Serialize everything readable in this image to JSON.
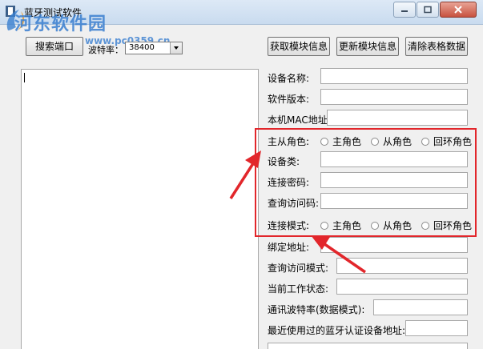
{
  "window": {
    "title": "蓝牙测试软件",
    "watermark": "河东软件园",
    "watermark_url": "www.pc0359.cn"
  },
  "toolbar": {
    "search_port_label": "搜索端口",
    "baud_label": "波特率：",
    "baud_value": "38400",
    "get_info_label": "获取模块信息",
    "update_info_label": "更新模块信息",
    "clear_table_label": "清除表格数据"
  },
  "fields": {
    "device_name": "设备名称:",
    "software_version": "软件版本:",
    "local_mac": "本机MAC地址:",
    "master_slave_role": "主从角色:",
    "device_class": "设备类:",
    "pair_password": "连接密码:",
    "inquiry_code": "查询访问码:",
    "connect_mode": "连接模式:",
    "bind_address": "绑定地址:",
    "inquiry_mode": "查询访问模式:",
    "current_state": "当前工作状态:",
    "baud_rate_data_mode": "通讯波特率(数据模式):",
    "recent_device_address": "最近使用过的蓝牙认证设备地址:"
  },
  "role_options": {
    "master": "主角色",
    "slave": "从角色",
    "loopback": "回环角色"
  },
  "mode_options": {
    "master": "主角色",
    "slave": "从角色",
    "loopback": "回环角色"
  },
  "colors": {
    "highlight": "#e2262b",
    "titlebar": "#c9dbef",
    "watermark": "#3a7fd0"
  }
}
